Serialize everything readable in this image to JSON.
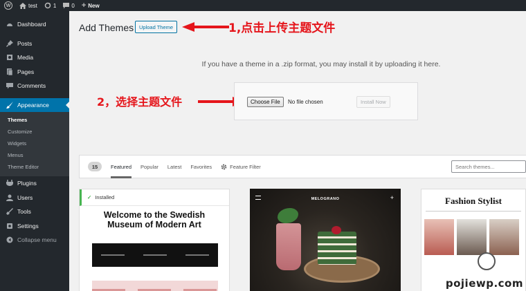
{
  "adminbar": {
    "site_name": "test",
    "updates": "1",
    "comments": "0",
    "new_label": "New"
  },
  "sidebar": {
    "items": [
      {
        "label": "Dashboard",
        "icon": "dashboard-icon"
      },
      {
        "label": "Posts",
        "icon": "pin-icon"
      },
      {
        "label": "Media",
        "icon": "media-icon"
      },
      {
        "label": "Pages",
        "icon": "pages-icon"
      },
      {
        "label": "Comments",
        "icon": "comments-icon"
      },
      {
        "label": "Appearance",
        "icon": "brush-icon"
      },
      {
        "label": "Plugins",
        "icon": "plugin-icon"
      },
      {
        "label": "Users",
        "icon": "users-icon"
      },
      {
        "label": "Tools",
        "icon": "tools-icon"
      },
      {
        "label": "Settings",
        "icon": "settings-icon"
      },
      {
        "label": "Collapse menu",
        "icon": "collapse-icon"
      }
    ],
    "submenu": [
      "Themes",
      "Customize",
      "Widgets",
      "Menus",
      "Theme Editor"
    ]
  },
  "page": {
    "title": "Add Themes",
    "upload_button": "Upload Theme",
    "help_text": "If you have a theme in a .zip format, you may install it by uploading it here.",
    "choose_file": "Choose File",
    "no_file": "No file chosen",
    "install_now": "Install Now"
  },
  "annotations": {
    "step1": "1,点击上传主题文件",
    "step2": "2，选择主题文件"
  },
  "filter": {
    "count": "15",
    "tabs": [
      "Featured",
      "Popular",
      "Latest",
      "Favorites"
    ],
    "feature_filter": "Feature Filter",
    "search_placeholder": "Search themes..."
  },
  "themes": {
    "installed_label": "Installed",
    "swedish_title": "Welcome to the Swedish Museum of Modern Art",
    "melo_label": "MELOGRANO",
    "fashion_title": "Fashion Stylist"
  },
  "watermark": "pojiewp.com",
  "colors": {
    "accent": "#0073aa",
    "annotation": "#e5151b",
    "installed": "#46b450"
  }
}
